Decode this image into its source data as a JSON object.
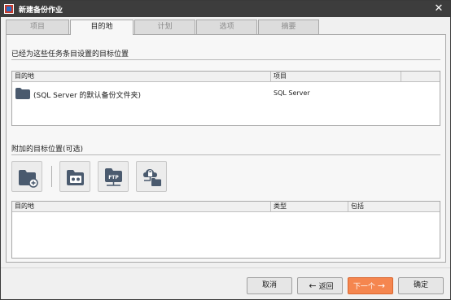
{
  "window": {
    "title": "新建备份作业",
    "close_glyph": "✕"
  },
  "tabs": [
    {
      "label": "项目",
      "active": false
    },
    {
      "label": "目的地",
      "active": true
    },
    {
      "label": "计划",
      "active": false
    },
    {
      "label": "选项",
      "active": false
    },
    {
      "label": "摘要",
      "active": false
    }
  ],
  "assigned": {
    "title": "已经为这些任务条目设置的目标位置",
    "columns": [
      "目的地",
      "项目"
    ],
    "rows": [
      {
        "destination": "(SQL Server 的默认备份文件夹)",
        "item": "SQL Server",
        "icon": "folder-icon"
      }
    ]
  },
  "additional": {
    "title": "附加的目标位置(可选)",
    "tools": [
      {
        "name": "add-local-folder-icon"
      },
      {
        "name": "add-tape-drive-icon"
      },
      {
        "name": "add-ftp-folder-icon"
      },
      {
        "name": "add-cloud-storage-icon"
      }
    ],
    "columns": [
      "目的地",
      "类型",
      "包括"
    ],
    "rows": []
  },
  "buttons": {
    "cancel": "取消",
    "back": "返回",
    "back_arrow": "←",
    "next": "下一个",
    "next_arrow": "→",
    "ok": "确定"
  },
  "colors": {
    "titlebar": "#3d3d3d",
    "primary_button": "#f5864f",
    "folder": "#4a5a6e"
  }
}
